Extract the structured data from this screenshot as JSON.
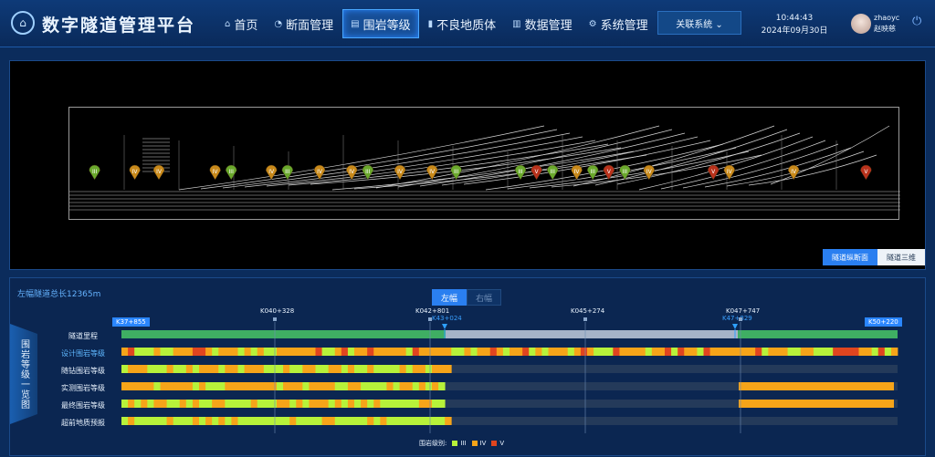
{
  "header": {
    "logo_glyph": "⌂",
    "title": "数字隧道管理平台",
    "nav": [
      {
        "icon": "⌂",
        "label": "首页"
      },
      {
        "icon": "◔",
        "label": "断面管理"
      },
      {
        "icon": "▤",
        "label": "围岩等级"
      },
      {
        "icon": "▮",
        "label": "不良地质体"
      },
      {
        "icon": "▥",
        "label": "数据管理"
      },
      {
        "icon": "⚙",
        "label": "系统管理"
      }
    ],
    "related_system": "关联系统 ⌄",
    "time": "10:44:43",
    "date": "2024年09月30日",
    "username": "zhaoyc",
    "display_name": "赵映慈",
    "power_glyph": "⏻"
  },
  "profile_view": {
    "buttons": [
      "隧道纵断面",
      "隧道三维"
    ],
    "markers": [
      {
        "grade": "III",
        "color": "#6aa82c",
        "pos": 0.02
      },
      {
        "grade": "IV",
        "color": "#c8891a",
        "pos": 0.07
      },
      {
        "grade": "IV",
        "color": "#c8891a",
        "pos": 0.1
      },
      {
        "grade": "IV",
        "color": "#c8891a",
        "pos": 0.17
      },
      {
        "grade": "III",
        "color": "#6aa82c",
        "pos": 0.19
      },
      {
        "grade": "IV",
        "color": "#c8891a",
        "pos": 0.24
      },
      {
        "grade": "III",
        "color": "#6aa82c",
        "pos": 0.26
      },
      {
        "grade": "IV",
        "color": "#c8891a",
        "pos": 0.3
      },
      {
        "grade": "IV",
        "color": "#c8891a",
        "pos": 0.34
      },
      {
        "grade": "III",
        "color": "#6aa82c",
        "pos": 0.36
      },
      {
        "grade": "IV",
        "color": "#c8891a",
        "pos": 0.4
      },
      {
        "grade": "IV",
        "color": "#c8891a",
        "pos": 0.44
      },
      {
        "grade": "III",
        "color": "#6aa82c",
        "pos": 0.47
      },
      {
        "grade": "III",
        "color": "#6aa82c",
        "pos": 0.55
      },
      {
        "grade": "V",
        "color": "#b8321c",
        "pos": 0.57
      },
      {
        "grade": "III",
        "color": "#6aa82c",
        "pos": 0.59
      },
      {
        "grade": "IV",
        "color": "#c8891a",
        "pos": 0.62
      },
      {
        "grade": "III",
        "color": "#6aa82c",
        "pos": 0.64
      },
      {
        "grade": "V",
        "color": "#b8321c",
        "pos": 0.66
      },
      {
        "grade": "III",
        "color": "#6aa82c",
        "pos": 0.68
      },
      {
        "grade": "IV",
        "color": "#c8891a",
        "pos": 0.71
      },
      {
        "grade": "V",
        "color": "#b8321c",
        "pos": 0.79
      },
      {
        "grade": "IV",
        "color": "#c8891a",
        "pos": 0.81
      },
      {
        "grade": "IV",
        "color": "#c8891a",
        "pos": 0.89
      },
      {
        "grade": "V",
        "color": "#b8321c",
        "pos": 0.98
      }
    ]
  },
  "overview": {
    "total_length": "左幅隧道总长12365m",
    "lr": [
      "左幅",
      "右幅"
    ],
    "side_title": "围岩等级一览图",
    "start_km": "K37+855",
    "end_km": "K50+220",
    "ticks": [
      "K040+328",
      "K042+801",
      "K045+274",
      "K047+747"
    ],
    "pointers": [
      "K43+024",
      "K47+829"
    ],
    "rows": [
      "隧道里程",
      "设计围岩等级",
      "随钻围岩等级",
      "实测围岩等级",
      "最终围岩等级",
      "超前地质预报"
    ],
    "legend": {
      "label": "围岩级别:",
      "g3": "III",
      "g4": "IV",
      "g5": "V"
    },
    "colors": {
      "g3": "#b7f23a",
      "g4": "#f6a419",
      "g5": "#e0451f",
      "empty": "#243a5a"
    }
  }
}
